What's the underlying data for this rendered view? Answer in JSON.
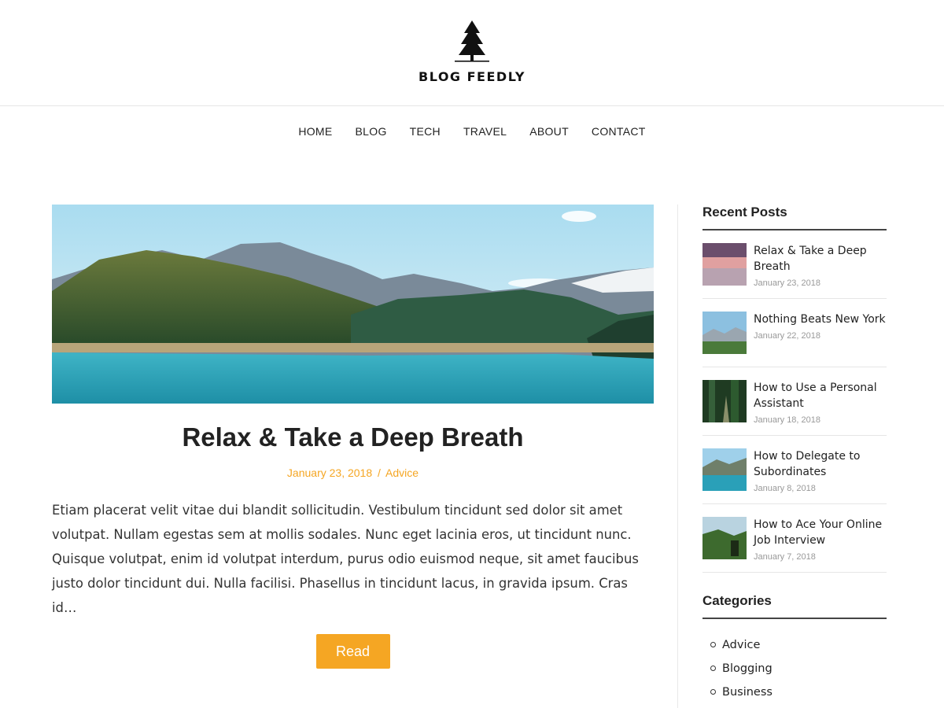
{
  "brand": {
    "name": "BLOG FEEDLY",
    "accent": "#f5a623"
  },
  "nav": {
    "items": [
      "HOME",
      "BLOG",
      "TECH",
      "TRAVEL",
      "ABOUT",
      "CONTACT"
    ]
  },
  "post": {
    "title": "Relax & Take a Deep Breath",
    "date": "January 23, 2018",
    "separator": "/",
    "category": "Advice",
    "excerpt": "Etiam placerat velit vitae dui blandit sollicitudin. Vestibulum tincidunt sed dolor sit amet volutpat. Nullam egestas sem at mollis sodales. Nunc eget lacinia eros, ut tincidunt nunc. Quisque volutpat, enim id volutpat interdum, purus odio euismod neque, sit amet faucibus justo dolor tincidunt dui. Nulla facilisi. Phasellus in tincidunt lacus, in gravida ipsum. Cras id…",
    "read_label": "Read"
  },
  "sidebar": {
    "recent_title": "Recent Posts",
    "recent": [
      {
        "title": "Relax & Take a Deep Breath",
        "date": "January 23, 2018"
      },
      {
        "title": "Nothing Beats New York",
        "date": "January 22, 2018"
      },
      {
        "title": "How to Use a Personal Assistant",
        "date": "January 18, 2018"
      },
      {
        "title": "How to Delegate to Subordinates",
        "date": "January 8, 2018"
      },
      {
        "title": "How to Ace Your Online Job Interview",
        "date": "January 7, 2018"
      }
    ],
    "categories_title": "Categories",
    "categories": [
      "Advice",
      "Blogging",
      "Business"
    ]
  }
}
